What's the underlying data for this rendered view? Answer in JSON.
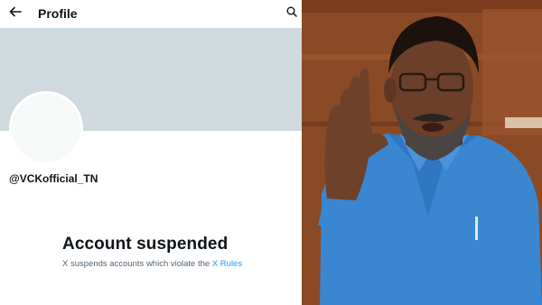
{
  "header": {
    "title": "Profile",
    "back_icon": "back-arrow-icon",
    "search_icon": "search-icon"
  },
  "profile": {
    "handle": "@VCKofficial_TN"
  },
  "suspension": {
    "title": "Account suspended",
    "message": "X suspends accounts which violate the",
    "link_text": "X Rules"
  },
  "colors": {
    "banner": "#cfd9de",
    "text_primary": "#0f1419",
    "text_secondary": "#536471",
    "link": "#1d9bf0"
  }
}
